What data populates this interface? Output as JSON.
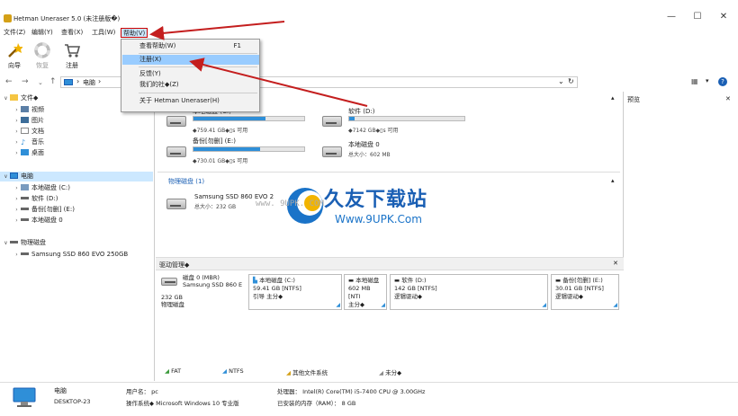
{
  "window": {
    "title": "Hetman Uneraser 5.0 (未注册版�)",
    "min": "—",
    "max": "☐",
    "close": "✕"
  },
  "menu": {
    "file": "文件(Z)",
    "edit": "编辑(Y)",
    "view": "查看(X)",
    "tools": "工具(W)",
    "help": "帮助(V)"
  },
  "help_menu": {
    "items": [
      {
        "label": "查看帮助(W)",
        "shortcut": "F1"
      },
      {
        "label": "注册(X)",
        "shortcut": ""
      },
      {
        "label": "反馈(Y)",
        "shortcut": ""
      },
      {
        "label": "我们的社◆(Z)",
        "shortcut": ""
      },
      {
        "label": "关于 Hetman Uneraser(H)",
        "shortcut": ""
      }
    ]
  },
  "toolbar": {
    "wizard": "向导",
    "recover": "恢复",
    "register": "注册"
  },
  "address": {
    "path_sep": "›",
    "location": "电脑",
    "refresh": "↻",
    "dropdown": "⌄"
  },
  "view_controls": {
    "layout": "▦",
    "arrow": "▾",
    "help": "?"
  },
  "preview": {
    "label": "预览",
    "close": "✕"
  },
  "tree": {
    "items": [
      {
        "label": "文件◆",
        "twisty": "∨"
      },
      {
        "label": "视频",
        "twisty": "›"
      },
      {
        "label": "图片",
        "twisty": "›"
      },
      {
        "label": "文档",
        "twisty": "›"
      },
      {
        "label": "音乐",
        "twisty": "›"
      },
      {
        "label": "桌面",
        "twisty": "›"
      },
      {
        "label": "电脑",
        "twisty": "∨"
      },
      {
        "label": "本地磁盘 (C:)",
        "twisty": "›"
      },
      {
        "label": "软件 (D:)",
        "twisty": "›"
      },
      {
        "label": "备份[勿删] (E:)",
        "twisty": "›"
      },
      {
        "label": "本地磁盘 0",
        "twisty": "›"
      },
      {
        "label": "物理磁盘",
        "twisty": "∨"
      },
      {
        "label": "Samsung SSD 860 EVO 250GB",
        "twisty": "›"
      }
    ]
  },
  "volumes": [
    {
      "name": "本地磁盘 (C:)",
      "info": "◆759.41 GB◆▯s 可用",
      "used": 0.65
    },
    {
      "name": "软件 (D:)",
      "info": "◆7142 GB◆▯s 可用",
      "used": 0.05
    },
    {
      "name": "备份[勿删] (E:)",
      "info": "◆730.01 GB◆▯s 可用",
      "used": 0.6
    },
    {
      "name": "本地磁盘 0",
      "info": "总大小：602 MB",
      "used": 0
    }
  ],
  "physical": {
    "section": "物理磁盘 (1)",
    "collapse": "▴",
    "disk_name": "Samsung SSD 860 EVO 2",
    "disk_size": "总大小：232 GB"
  },
  "disk_manager": {
    "title": "驱动管理◆",
    "close": "✕",
    "disk": {
      "name": "磁盘 0 (MBR)",
      "model": "Samsung SSD 860 E",
      "size": "232 GB",
      "type": "物理磁盘"
    },
    "partitions": [
      {
        "name": "本地磁盘 (C:)",
        "fs": "59.41 GB [NTFS]",
        "role": "引导 主分◆"
      },
      {
        "name": "本地磁盘",
        "fs": "602 MB [NTI",
        "role": "主分◆"
      },
      {
        "name": "软件 (D:)",
        "fs": "142 GB [NTFS]",
        "role": "逻辑驱动◆"
      },
      {
        "name": "备份[勿删] (E:)",
        "fs": "30.01 GB [NTFS]",
        "role": "逻辑驱动◆"
      }
    ],
    "legend": [
      "FAT",
      "NTFS",
      "其他文件系统",
      "未分◆"
    ]
  },
  "status": {
    "computer": "电脑",
    "host": "DESKTOP-23",
    "user_label": "用户名：",
    "user": "pc",
    "os_label": "操作系统◆",
    "os": "Microsoft Windows 10 专业版",
    "cpu_label": "处理器：",
    "cpu": "Intel(R) Core(TM) i5-7400 CPU @ 3.00GHz",
    "ram_label": "已安装的内存（RAM）：",
    "ram": "8 GB"
  },
  "watermark": {
    "cn": "久友下载站",
    "url": "Www.9UPK.Com",
    "small": "www. 9UPK. COM"
  },
  "colors": {
    "accent": "#2f8fd8",
    "highlight": "#99ccff",
    "arrow": "#c41e1e"
  }
}
